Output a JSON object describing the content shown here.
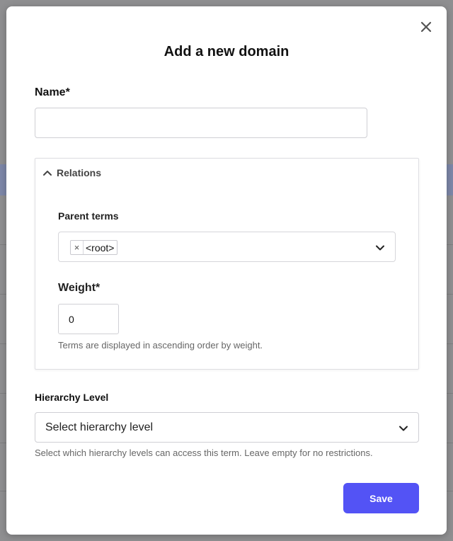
{
  "modal": {
    "title": "Add a new domain",
    "name_label": "Name*",
    "name_value": "",
    "relations": {
      "title": "Relations",
      "expanded": true,
      "parent_terms_label": "Parent terms",
      "parent_terms_selected": [
        "<root>"
      ],
      "tag_remove_glyph": "×",
      "weight_label": "Weight*",
      "weight_value": "0",
      "weight_help": "Terms are displayed in ascending order by weight."
    },
    "hierarchy": {
      "label": "Hierarchy Level",
      "placeholder": "Select hierarchy level",
      "help": "Select which hierarchy levels can access this term. Leave empty for no restrictions."
    },
    "save_label": "Save"
  },
  "icons": {
    "close": "close-icon",
    "relations_toggle": "chevron-up-icon",
    "parent_dropdown": "chevron-down-icon",
    "hierarchy_dropdown": "chevron-down-icon"
  },
  "colors": {
    "primary": "#5353f5",
    "overlay": "#8f8f91",
    "modal_bg": "#ffffff"
  }
}
